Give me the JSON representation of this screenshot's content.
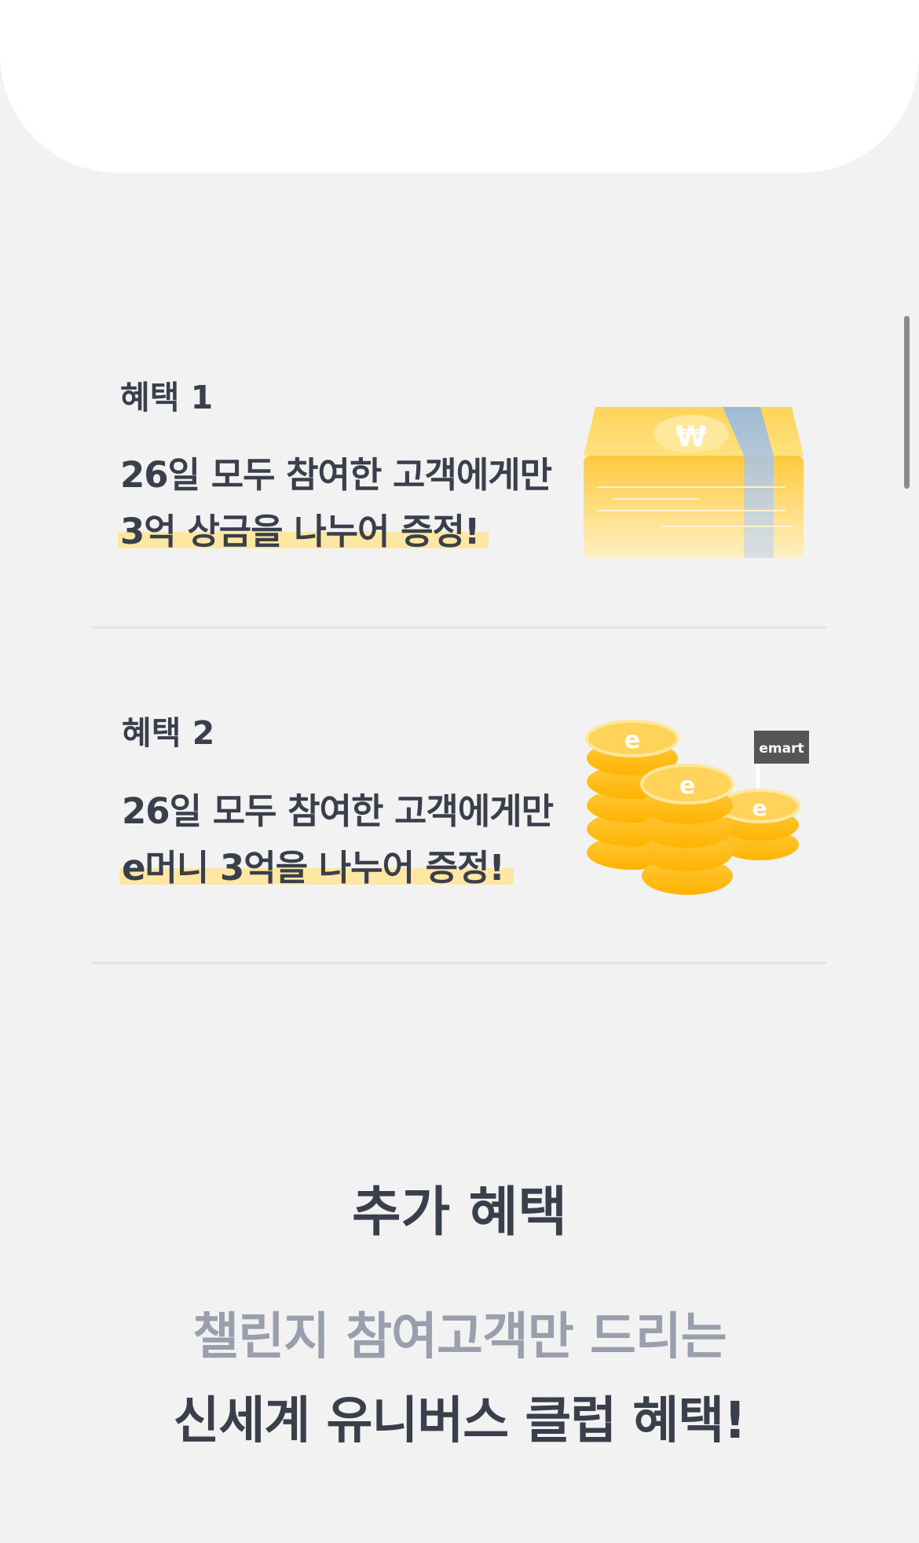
{
  "benefits": [
    {
      "tag": "혜택 1",
      "line1": "26일 모두 참여한 고객에게만",
      "line2": "3억 상금을 나누어 증정!",
      "icon": "money-stack-icon"
    },
    {
      "tag": "혜택 2",
      "line1": "26일 모두 참여한 고객에게만",
      "line2": "e머니 3억을 나누어 증정!",
      "icon": "emart-coins-icon",
      "badge": "emart"
    }
  ],
  "extra": {
    "title": "추가 혜택",
    "subtitle": "챌린지 참여고객만 드리는",
    "subtitle2": "신세계 유니버스 클럽 혜택!"
  },
  "colors": {
    "background": "#f2f2f2",
    "text": "#3a3f4c",
    "muted": "#9a9fae",
    "highlight": "#fde7a3",
    "gold": "#ffc93c"
  }
}
